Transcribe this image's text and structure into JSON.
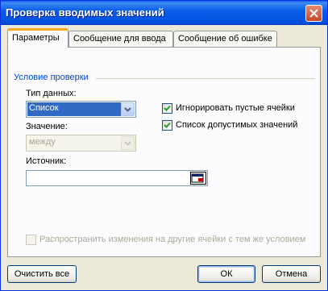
{
  "window": {
    "title": "Проверка вводимых значений"
  },
  "tabs": [
    {
      "label": "Параметры",
      "active": true
    },
    {
      "label": "Сообщение для ввода",
      "active": false
    },
    {
      "label": "Сообщение об ошибке",
      "active": false
    }
  ],
  "condition": {
    "section_label": "Условие проверки",
    "data_type_label": "Тип данных:",
    "data_type_value": "Список",
    "value_label": "Значение:",
    "value_value": "между",
    "source_label": "Источник:",
    "source_value": ""
  },
  "checkboxes": {
    "ignore_blank": {
      "label": "Игнорировать пустые ячейки",
      "checked": true
    },
    "in_cell_dropdown": {
      "label": "Список допустимых значений",
      "checked": true
    },
    "apply_changes": {
      "label": "Распространить изменения на другие ячейки с тем же условием",
      "checked": false,
      "enabled": false
    }
  },
  "buttons": {
    "clear_all": "Очистить все",
    "ok": "ОК",
    "cancel": "Отмена"
  },
  "colors": {
    "title_bar": "#0a5ee8",
    "section_label": "#0046d5",
    "active_tab_accent": "#f5a623",
    "selection": "#316ac5",
    "dialog_bg": "#ece9d8"
  },
  "icons": {
    "close": "close-icon",
    "dropdown": "chevron-down-icon",
    "check": "check-icon",
    "range_picker": "range-picker-icon"
  }
}
